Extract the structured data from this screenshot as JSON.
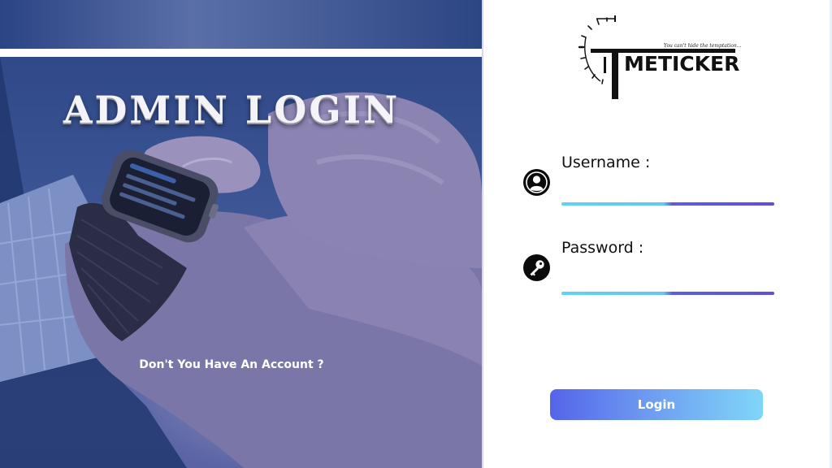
{
  "hero": {
    "title": "ADMIN LOGIN",
    "signup_link": "Don't You Have An Account ?"
  },
  "brand": {
    "wordmark": "METICKER",
    "tagline": "You can't hide the temptation..."
  },
  "form": {
    "username": {
      "label": "Username :",
      "value": "",
      "placeholder": ""
    },
    "password": {
      "label": "Password :",
      "value": "",
      "placeholder": ""
    },
    "login_label": "Login"
  },
  "icons": {
    "username": "user-icon",
    "password": "key-icon"
  },
  "colors": {
    "accent_start": "#5464ea",
    "accent_end": "#7fd6f8",
    "underline_cyan": "#5fd3f4",
    "underline_violet": "#5f50dc",
    "hero_blue": "#3a5393"
  }
}
